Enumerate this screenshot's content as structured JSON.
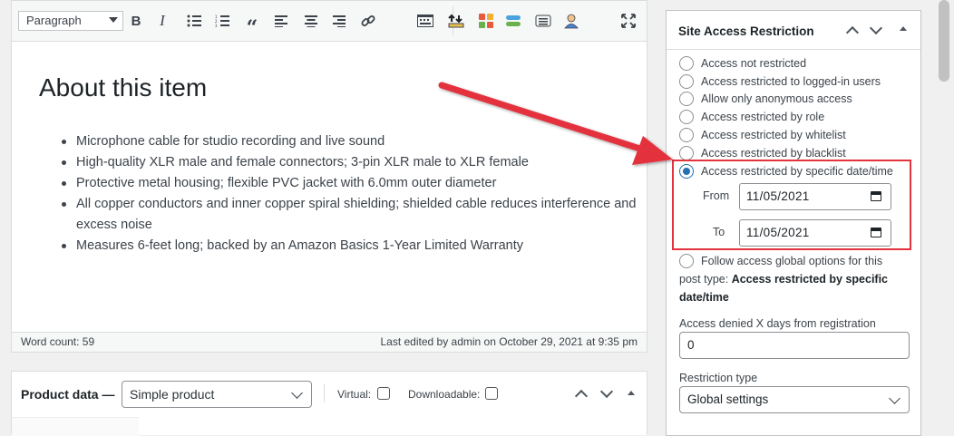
{
  "editor": {
    "format_select": "Paragraph",
    "toolbar_icons": [
      "bold-icon",
      "italic-icon",
      "bulleted-list-icon",
      "numbered-list-icon",
      "blockquote-icon",
      "align-left-icon",
      "align-center-icon",
      "align-right-icon",
      "link-icon",
      "toolbar-toggle-icon",
      "upload-icon",
      "blocks-icon",
      "shortcode-icon",
      "document-icon",
      "user-icon",
      "fullscreen-icon"
    ],
    "heading": "About this item",
    "bullets": [
      "Microphone cable for studio recording and live sound",
      "High-quality XLR male and female connectors; 3-pin XLR male to XLR female",
      "Protective metal housing; flexible PVC jacket with 6.0mm outer diameter",
      "All copper conductors and inner copper spiral shielding; shielded cable reduces interference and excess noise",
      "Measures 6-feet long; backed by an Amazon Basics 1-Year Limited Warranty"
    ],
    "word_count": "Word count: 59",
    "last_edited": "Last edited by admin on October 29, 2021 at 9:35 pm"
  },
  "product_data": {
    "title": "Product data —",
    "type_select": "Simple product",
    "virtual_label": "Virtual:",
    "downloadable_label": "Downloadable:"
  },
  "access_panel": {
    "title": "Site Access Restriction",
    "options": [
      {
        "label": "Access not restricted",
        "checked": false
      },
      {
        "label": "Access restricted to logged-in users",
        "checked": false
      },
      {
        "label": "Allow only anonymous access",
        "checked": false
      },
      {
        "label": "Access restricted by role",
        "checked": false
      },
      {
        "label": "Access restricted by whitelist",
        "checked": false
      },
      {
        "label": "Access restricted by blacklist",
        "checked": false
      },
      {
        "label": "Access restricted by specific date/time",
        "checked": true
      }
    ],
    "from_label": "From",
    "from_value": "11/05/2021",
    "to_label": "To",
    "to_value": "11/05/2021",
    "follow_label": "Follow access global options for this post type:",
    "follow_value": "Access restricted by specific date/time",
    "days_label": "Access denied X days from registration",
    "days_value": "0",
    "restriction_type_label": "Restriction type",
    "restriction_type_value": "Global settings"
  },
  "colors": {
    "accent": "#2271b1",
    "highlight": "#e3333d"
  }
}
